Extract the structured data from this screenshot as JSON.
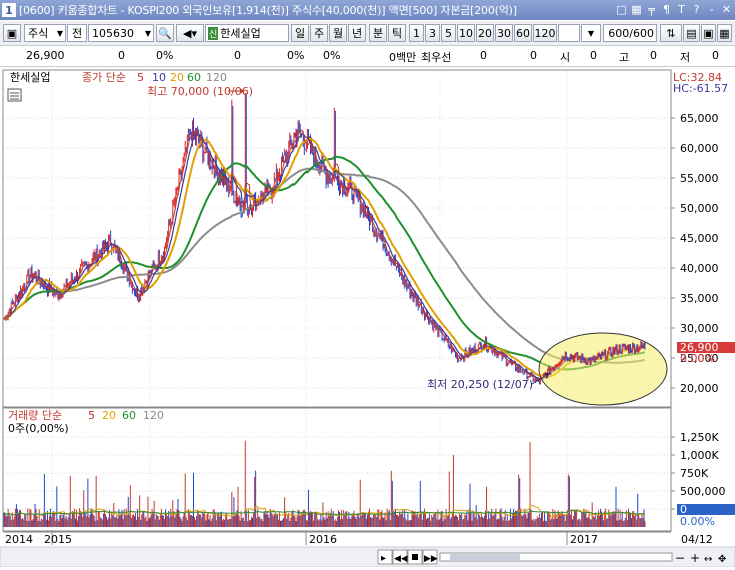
{
  "window": {
    "number": "1",
    "title": "[0600] 키움종합차트 - KOSPI200 외국인보유[1,914(천)] 주식수[40,000(천)] 액면[500] 자본금[200(억)]",
    "buttons": [
      "□",
      "▦",
      "╤",
      "¶",
      "T",
      "?",
      "-",
      "✕"
    ]
  },
  "toolbar": {
    "market": "주식",
    "market_select": "전",
    "code": "105630",
    "stock_name": "한세실업",
    "period_tabs": [
      "일",
      "주",
      "월",
      "년",
      "분",
      "틱"
    ],
    "selected_period": "일",
    "minute_options": [
      "1",
      "3",
      "5",
      "10",
      "20",
      "30",
      "60",
      "120"
    ],
    "count": "600",
    "count_total": "/600"
  },
  "info": {
    "price": "26,900",
    "change": "0",
    "change_pct": "0%",
    "volume": "0",
    "v_pct1": "0%",
    "v_pct2": "0%",
    "amount": "0백만",
    "best_ask_label": "최우선",
    "ask1": "0",
    "ask2": "0",
    "open_label": "시",
    "open": "0",
    "high_label": "고",
    "high": "0",
    "low_label": "저",
    "low": "0"
  },
  "price_panel": {
    "stock_label": "한세실업",
    "legend_prefix": "종가 단순",
    "ma_periods": [
      "5",
      "10",
      "20",
      "60",
      "120"
    ],
    "ma_colors": [
      "#c0392b",
      "#3a3aa0",
      "#e0a000",
      "#1f8f2f",
      "#8a8a8a"
    ],
    "lc": "LC:32.84",
    "hc": "HC:-61.57",
    "high_annot": "최고 70,000 (10/06)",
    "low_annot": "최저 20,250 (12/07)",
    "last_price": "26,900",
    "last_pct": "0.00%",
    "y_ticks": [
      "65,000",
      "60,000",
      "55,000",
      "50,000",
      "45,000",
      "40,000",
      "35,000",
      "30,000",
      "25,000",
      "20,000"
    ],
    "y_tick_values": [
      65000,
      60000,
      55000,
      50000,
      45000,
      40000,
      35000,
      30000,
      25000,
      20000
    ]
  },
  "volume_panel": {
    "legend_prefix": "거래량 단순",
    "ma_periods": [
      "5",
      "20",
      "60",
      "120"
    ],
    "current": "0주(0,00%)",
    "y_ticks": [
      "1,250K",
      "1,000K",
      "750K",
      "500,000",
      "250,000"
    ],
    "y_tick_values": [
      1250000,
      1000000,
      750000,
      500000,
      250000
    ],
    "last_vol": "0",
    "last_vol_pct": "0.00%"
  },
  "x_axis": {
    "labels": [
      "2014",
      "2015",
      "2016",
      "2017"
    ],
    "last_date": "04/12"
  },
  "chart_data": {
    "type": "line",
    "title": "한세실업",
    "xlabel": "",
    "ylabel": "",
    "ylim": [
      17500,
      70000
    ],
    "x": [
      "2014-11",
      "2015-01",
      "2015-03",
      "2015-05",
      "2015-06",
      "2015-07",
      "2015-08",
      "2015-09",
      "2015-10",
      "2015-11",
      "2016-01",
      "2016-03",
      "2016-04",
      "2016-05",
      "2016-06",
      "2016-07",
      "2016-08",
      "2016-09",
      "2016-10",
      "2016-11",
      "2016-12",
      "2017-01",
      "2017-02",
      "2017-03",
      "2017-04"
    ],
    "series": [
      {
        "name": "종가",
        "values": [
          31500,
          39000,
          35500,
          40000,
          44500,
          35500,
          43000,
          63000,
          56000,
          50000,
          53000,
          63000,
          56000,
          53000,
          46000,
          37500,
          31000,
          25000,
          27500,
          24000,
          21000,
          25500,
          24500,
          26500,
          26900
        ]
      }
    ],
    "annotations": [
      {
        "label": "최고 70,000 (10/06)",
        "value": 70000
      },
      {
        "label": "최저 20,250 (12/07)",
        "value": 20250
      }
    ]
  }
}
